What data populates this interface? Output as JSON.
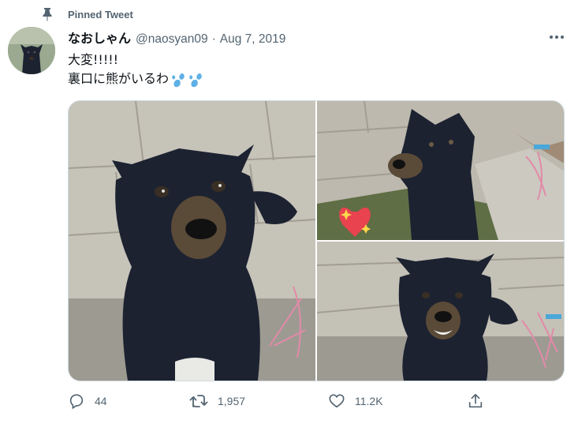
{
  "pinned": {
    "label": "Pinned Tweet"
  },
  "tweet": {
    "display_name": "なおしゃん",
    "handle": "@naosyan09",
    "separator": "·",
    "date": "Aug 7, 2019",
    "lines": [
      "大変!!!!!",
      "裏口に熊がいるわ"
    ],
    "emoji": "sweat-droplets-icon"
  },
  "actions": {
    "reply_count": "44",
    "retweet_count": "1,957",
    "like_count": "11.2K"
  },
  "colors": {
    "secondary_text": "#536471",
    "primary_text": "#0f1419",
    "border": "#cfd9de",
    "emoji_blue": "#5fb0e6",
    "heart_red": "#e8434f"
  }
}
